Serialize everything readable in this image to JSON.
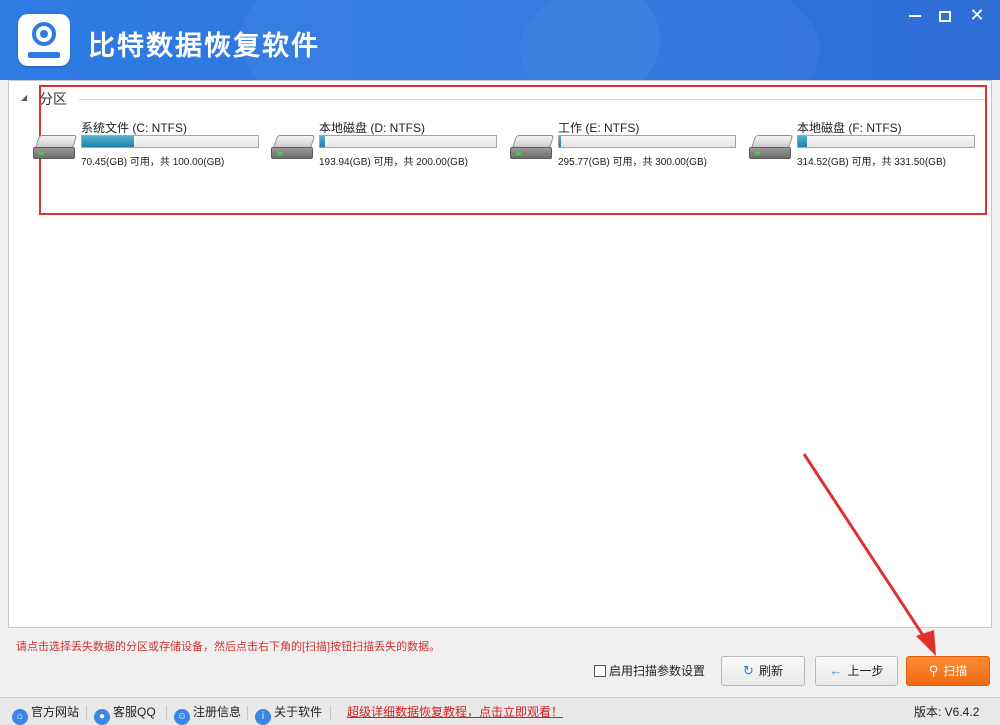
{
  "app": {
    "title": "比特数据恢复软件"
  },
  "panel": {
    "group_label": "分区",
    "drives": [
      {
        "name": "系统文件 (C: NTFS)",
        "info": "70.45(GB) 可用，共 100.00(GB)",
        "used_fraction": 0.2955
      },
      {
        "name": "本地磁盘 (D: NTFS)",
        "info": "193.94(GB) 可用，共 200.00(GB)",
        "used_fraction": 0.0303
      },
      {
        "name": "工作 (E: NTFS)",
        "info": "295.77(GB) 可用，共 300.00(GB)",
        "used_fraction": 0.0141
      },
      {
        "name": "本地磁盘 (F: NTFS)",
        "info": "314.52(GB) 可用，共 331.50(GB)",
        "used_fraction": 0.0512
      }
    ]
  },
  "hint": "请点击选择丢失数据的分区或存储设备，然后点击右下角的[扫描]按钮扫描丢失的数据。",
  "actions": {
    "scan_options_label": "启用扫描参数设置",
    "refresh_label": "刷新",
    "prev_label": "上一步",
    "scan_label": "扫描"
  },
  "footer": {
    "website": "官方网站",
    "qq": "客服QQ",
    "register": "注册信息",
    "about": "关于软件",
    "tutorial_link": "超级详细数据恢复教程，点击立即观看！",
    "version": "版本: V6.4.2"
  },
  "colors": {
    "accent": "#2f7be4",
    "scan_button": "#f06a14",
    "annotation": "#e03030"
  },
  "icons": [
    "app-logo-icon",
    "minimize-icon",
    "maximize-icon",
    "close-icon",
    "collapse-triangle-icon",
    "hard-drive-icon",
    "refresh-icon",
    "arrow-left-icon",
    "search-icon",
    "home-icon",
    "qq-icon",
    "user-icon",
    "info-icon"
  ]
}
